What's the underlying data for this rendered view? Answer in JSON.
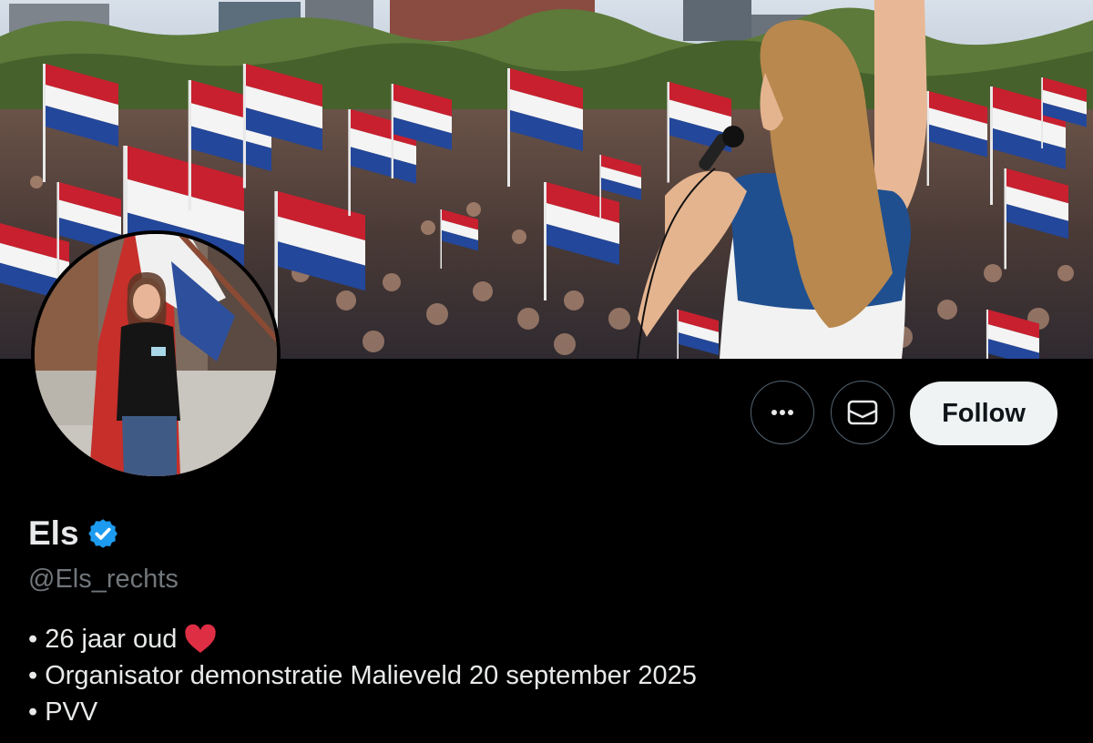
{
  "profile": {
    "display_name": "Els",
    "handle": "@Els_rechts",
    "verified": true,
    "bio": [
      "• 26 jaar oud",
      "• Organisator demonstratie Malieveld 20 september 2025",
      "• PVV"
    ]
  },
  "actions": {
    "follow_label": "Follow",
    "more_icon": "ellipsis-icon",
    "message_icon": "envelope-icon"
  },
  "colors": {
    "background": "#000000",
    "verified_blue": "#1d9bf0",
    "heart_red": "#f91880",
    "secondary_text": "#71767b",
    "follow_bg": "#eff3f4"
  }
}
